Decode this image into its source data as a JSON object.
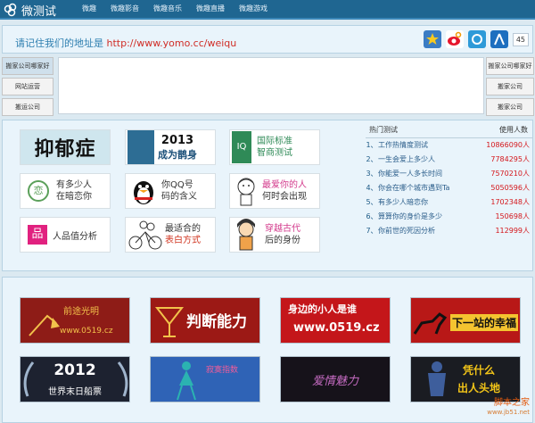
{
  "nav": {
    "logo": "微测试",
    "links": [
      "微趣",
      "微趣影音",
      "微趣音乐",
      "微趣直播",
      "微趣游戏"
    ]
  },
  "address": {
    "text": "请记住我们的地址是",
    "url": "http://www.yomo.cc/weiqu",
    "share_count": "45"
  },
  "side_left": {
    "buttons": [
      "搬家公司哪家好",
      "网站运营",
      "搬运公司"
    ]
  },
  "side_right": {
    "buttons": [
      "搬家公司哪家好",
      "搬家公司",
      "搬家公司"
    ]
  },
  "tiles": [
    {
      "lines": [
        "抑郁症"
      ]
    },
    {
      "lines": [
        "2013",
        "成为鹊身"
      ]
    },
    {
      "lines": [
        "IQ",
        "国际标准",
        "智商测试"
      ]
    },
    {
      "lines": [
        "恋",
        "有多少人",
        "在暗恋你"
      ]
    },
    {
      "lines": [
        "你QQ号",
        "码的含义"
      ]
    },
    {
      "lines": [
        "最爱你的人",
        "何时会出现"
      ]
    },
    {
      "lines": [
        "品",
        "人品值分析"
      ]
    },
    {
      "lines": [
        "最适合的",
        "表白方式"
      ]
    },
    {
      "lines": [
        "穿越古代",
        "后的身份"
      ]
    }
  ],
  "hot": {
    "header": "热门测试",
    "header_count": "使用人数",
    "items": [
      {
        "num": "1、",
        "title": "工作热情度测试",
        "count": "10866090人"
      },
      {
        "num": "2、",
        "title": "一生会爱上多少人",
        "count": "7784295人"
      },
      {
        "num": "3、",
        "title": "你能爱一人多长时间",
        "count": "7570210人"
      },
      {
        "num": "4、",
        "title": "你会在哪个城市遇到Ta",
        "count": "5050596人"
      },
      {
        "num": "5、",
        "title": "有多少人暗恋你",
        "count": "1702348人"
      },
      {
        "num": "6、",
        "title": "算算你的身价是多少",
        "count": "150698人"
      },
      {
        "num": "7、",
        "title": "你前世的死因分析",
        "count": "112999人"
      }
    ]
  },
  "bottom_tiles": [
    {
      "lines": [
        "前途光明",
        "www.0519.cz"
      ]
    },
    {
      "lines": [
        "判断能力"
      ]
    },
    {
      "lines": [
        "身边的小人是谁",
        "www.0519.cz"
      ]
    },
    {
      "lines": [
        "下一站的幸福"
      ]
    },
    {
      "lines": [
        "2012",
        "世界末日船票"
      ]
    },
    {
      "lines": [
        "寂寞指数"
      ]
    },
    {
      "lines": [
        "爱情魅力"
      ]
    },
    {
      "lines": [
        "凭什么",
        "出人头地"
      ]
    }
  ],
  "watermark": {
    "line1": "脚本之家",
    "line2": "www.jb51.net"
  },
  "colors": {
    "nav": "#1f6691",
    "accent": "#d02d26",
    "link": "#2a5d8a"
  }
}
